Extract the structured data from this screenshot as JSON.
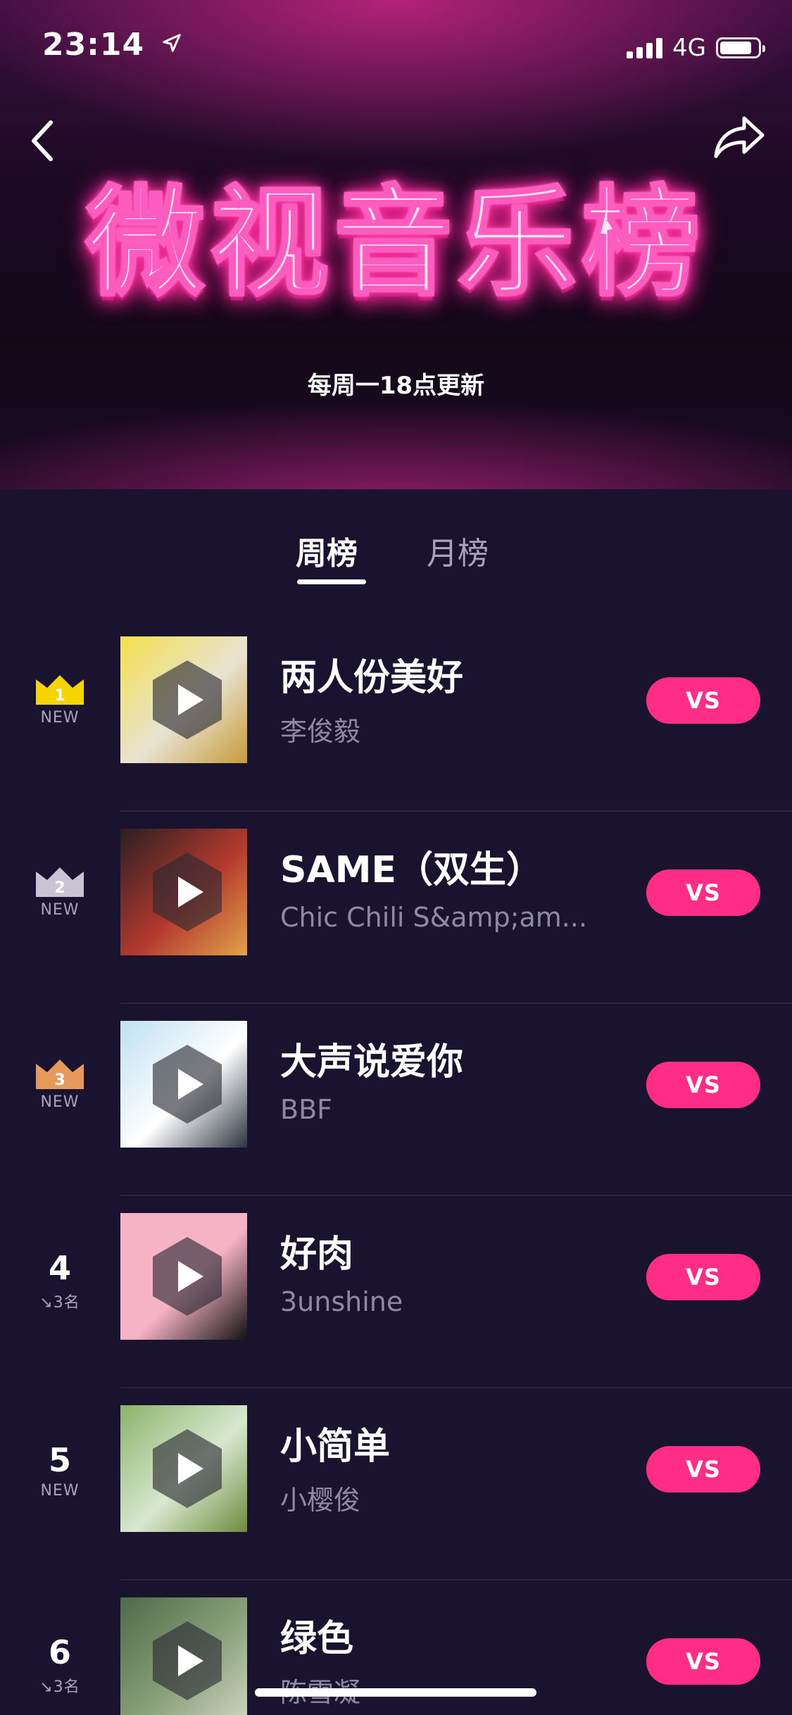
{
  "status_bar": {
    "time": "23:14",
    "network": "4G"
  },
  "header": {
    "title": "微视音乐榜",
    "subtitle": "每周一18点更新",
    "back_icon": "chevron-left-icon",
    "share_icon": "share-arrow-icon"
  },
  "tabs": [
    {
      "label": "周榜",
      "active": true
    },
    {
      "label": "月榜",
      "active": false
    }
  ],
  "colors": {
    "accent": "#ff2d86",
    "background": "#1a1330",
    "crown_gold": "#f5d400",
    "crown_silver": "#c8c4d4",
    "crown_bronze": "#e79a5a"
  },
  "songs": [
    {
      "rank": "1",
      "change": "NEW",
      "title": "两人份美好",
      "artist": "李俊毅",
      "button": "VS",
      "cover_colors": [
        "#f4e04d",
        "#e8e3d2",
        "#c79b3a"
      ]
    },
    {
      "rank": "2",
      "change": "NEW",
      "title": "SAME（双生）",
      "artist": "Chic Chili S&amp;am...",
      "button": "VS",
      "cover_colors": [
        "#2a1f22",
        "#b3392f",
        "#e2a24a"
      ]
    },
    {
      "rank": "3",
      "change": "NEW",
      "title": "大声说爱你",
      "artist": "BBF",
      "button": "VS",
      "cover_colors": [
        "#bfe0f2",
        "#ffffff",
        "#2c3340"
      ]
    },
    {
      "rank": "4",
      "change": "↘3名",
      "title": "好肉",
      "artist": "3unshine",
      "button": "VS",
      "cover_colors": [
        "#f7b3c6",
        "#f7b3c6",
        "#111111"
      ]
    },
    {
      "rank": "5",
      "change": "NEW",
      "title": "小简单",
      "artist": "小樱俊",
      "button": "VS",
      "cover_colors": [
        "#8ab36a",
        "#d8e8d0",
        "#6f8a3e"
      ]
    },
    {
      "rank": "6",
      "change": "↘3名",
      "title": "绿色",
      "artist": "陈雪凝",
      "button": "VS",
      "cover_colors": [
        "#4d6b47",
        "#8aa07b",
        "#cfd6c4"
      ]
    }
  ]
}
